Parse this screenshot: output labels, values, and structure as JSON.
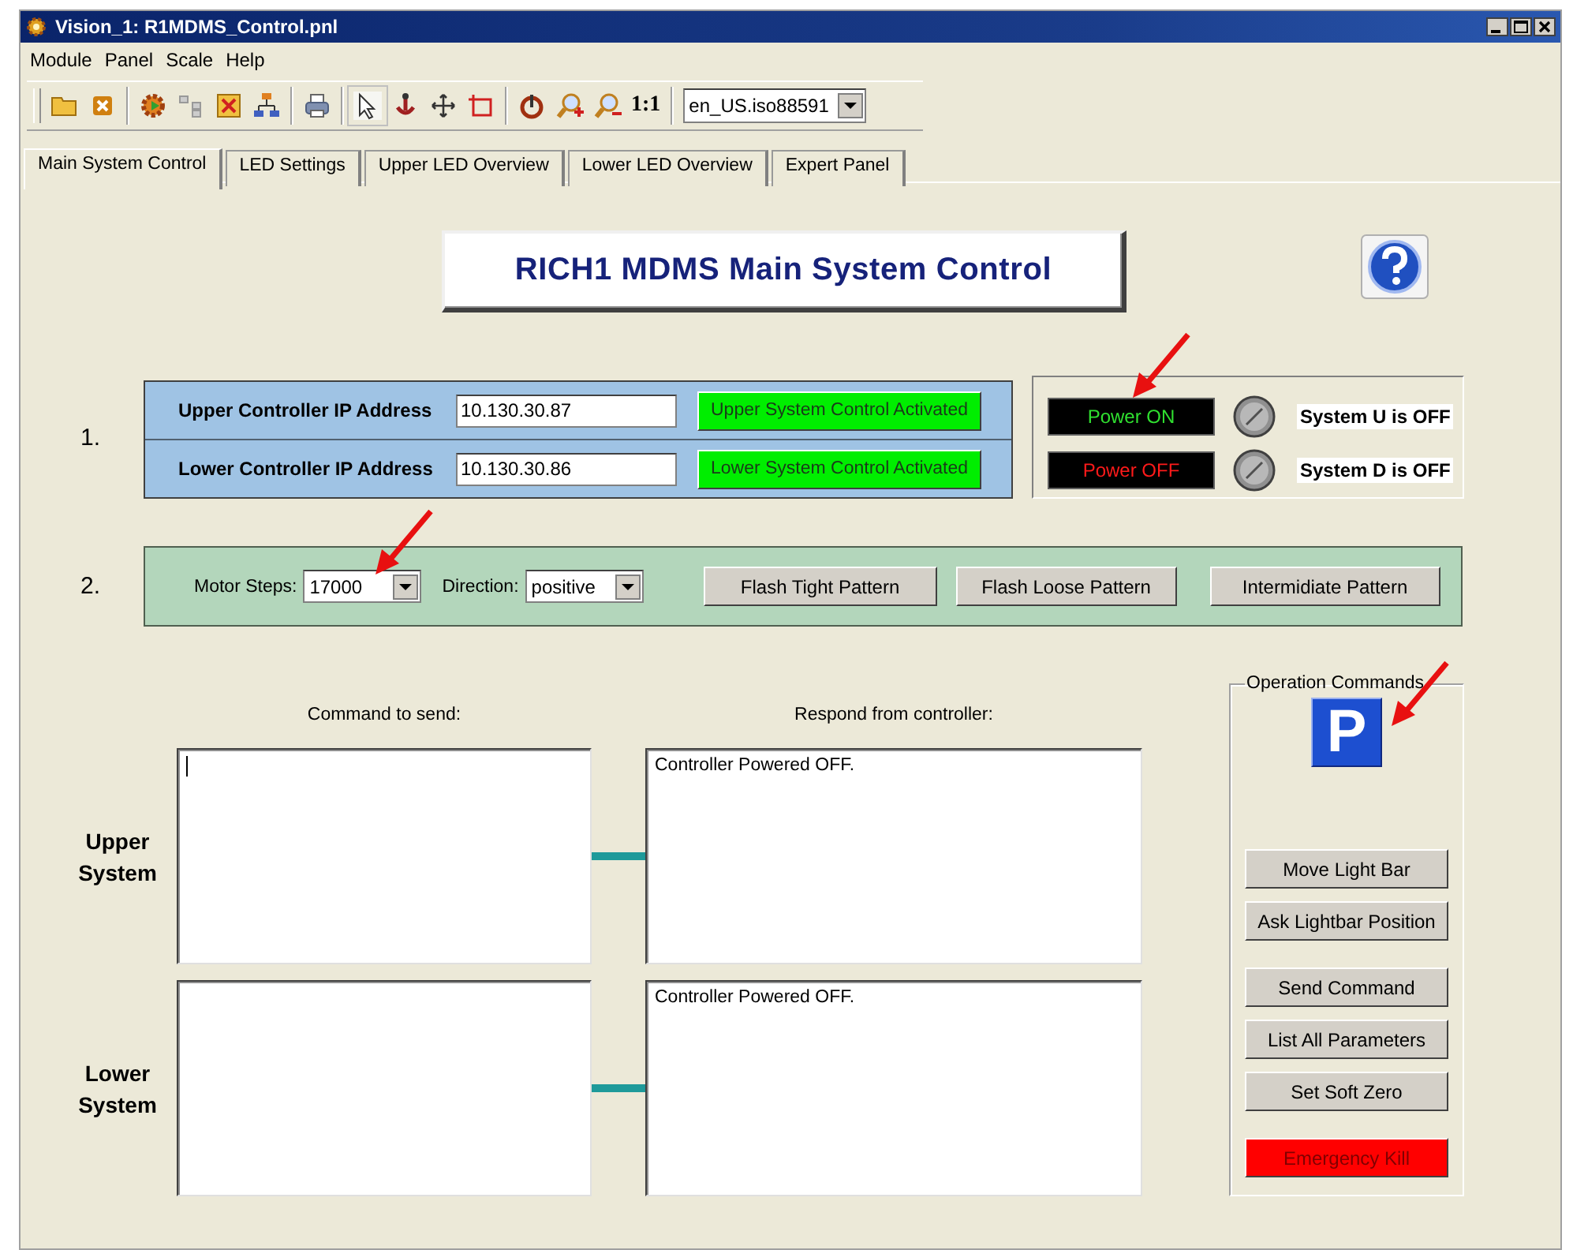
{
  "window": {
    "title": "Vision_1: R1MDMS_Control.pnl"
  },
  "menu": [
    {
      "label": "Module"
    },
    {
      "label": "Panel"
    },
    {
      "label": "Scale"
    },
    {
      "label": "Help"
    }
  ],
  "toolbar": {
    "zoom_reset": "1:1",
    "locale": "en_US.iso88591"
  },
  "tabs": [
    {
      "label": "Main System Control",
      "selected": true
    },
    {
      "label": "LED Settings",
      "selected": false
    },
    {
      "label": "Upper LED Overview",
      "selected": false
    },
    {
      "label": "Lower LED Overview",
      "selected": false
    },
    {
      "label": "Expert Panel",
      "selected": false
    }
  ],
  "header": {
    "title": "RICH1 MDMS Main System Control"
  },
  "step1": {
    "number": "1.",
    "controllers": [
      {
        "label": "Upper Controller IP Address",
        "value": "10.130.30.87",
        "status": "Upper System Control Activated",
        "active": true
      },
      {
        "label": "Lower Controller IP Address",
        "value": "10.130.30.86",
        "status": "Lower System Control Activated",
        "active": true
      }
    ],
    "power": [
      {
        "display": "Power ON",
        "on": true,
        "label": "System U is OFF"
      },
      {
        "display": "Power OFF",
        "on": false,
        "label": "System D is OFF"
      }
    ]
  },
  "step2": {
    "number": "2.",
    "motor_label": "Motor Steps:",
    "motor_value": "17000",
    "direction_label": "Direction:",
    "direction_value": "positive",
    "buttons": [
      "Flash Tight Pattern",
      "Flash Loose Pattern",
      "Intermidiate Pattern"
    ]
  },
  "console": {
    "command_heading": "Command to send:",
    "response_heading": "Respond from controller:",
    "systems": [
      {
        "label": "Upper System",
        "focused": true,
        "response": "Controller Powered OFF."
      },
      {
        "label": "Lower System",
        "focused": false,
        "response": "Controller Powered OFF."
      }
    ]
  },
  "operation": {
    "legend": "Operation Commands",
    "parking_button": "P",
    "groups": [
      [
        {
          "label": "Move Light Bar",
          "kind": "normal"
        },
        {
          "label": "Ask Lightbar Position",
          "kind": "normal"
        }
      ],
      [
        {
          "label": "Send Command",
          "kind": "normal"
        },
        {
          "label": "List All Parameters",
          "kind": "normal"
        },
        {
          "label": "Set Soft Zero",
          "kind": "normal"
        }
      ],
      [
        {
          "label": "Emergency Kill",
          "kind": "danger"
        }
      ]
    ]
  }
}
